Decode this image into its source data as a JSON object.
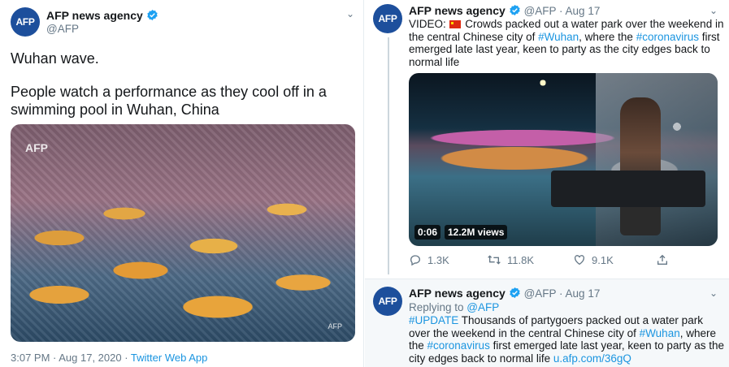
{
  "left_tweet": {
    "avatar_text": "AFP",
    "name": "AFP news agency",
    "handle": "@AFP",
    "text_line1": "Wuhan wave.",
    "text_line2": "People watch a performance as they cool off in a swimming pool in Wuhan, China",
    "photo": {
      "logo_text": "AFP",
      "credit_text": "AFP"
    },
    "meta": {
      "timestamp": "3:07 PM · Aug 17, 2020 · ",
      "source": "Twitter Web App"
    }
  },
  "right_tweet_1": {
    "avatar_text": "AFP",
    "name": "AFP news agency",
    "handle": "@AFP",
    "date": "· Aug 17",
    "text": {
      "prefix": "VIDEO:",
      "part1": " Crowds packed out a water park over the weekend in the central Chinese city of ",
      "hashtag1": "#Wuhan",
      "part2": ", where the ",
      "hashtag2": "#coronavirus",
      "part3": " first emerged late last year, keen to party as the city edges back to normal life"
    },
    "video": {
      "duration": "0:06",
      "views": "12.2M views"
    },
    "actions": {
      "replies": "1.3K",
      "retweets": "11.8K",
      "likes": "9.1K"
    }
  },
  "right_tweet_2": {
    "avatar_text": "AFP",
    "name": "AFP news agency",
    "handle": "@AFP",
    "date": "· Aug 17",
    "replying_prefix": "Replying to ",
    "replying_to": "@AFP",
    "text": {
      "hashtag1": "#UPDATE",
      "part1": " Thousands of partygoers packed out a water park over the weekend in the central Chinese city of ",
      "hashtag2": "#Wuhan",
      "part2": ", where the ",
      "hashtag3": "#coronavirus",
      "part3": " first emerged late last year, keen to party as the city edges back to normal life ",
      "link": "u.afp.com/36gQ"
    }
  },
  "colors": {
    "link": "#1b95e0",
    "secondary": "#657786",
    "avatar": "#1d4f9c",
    "verified": "#1da1f2"
  },
  "icons": [
    "verified-icon",
    "chevron-down-icon",
    "reply-icon",
    "retweet-icon",
    "like-icon",
    "share-icon",
    "china-flag-icon"
  ]
}
